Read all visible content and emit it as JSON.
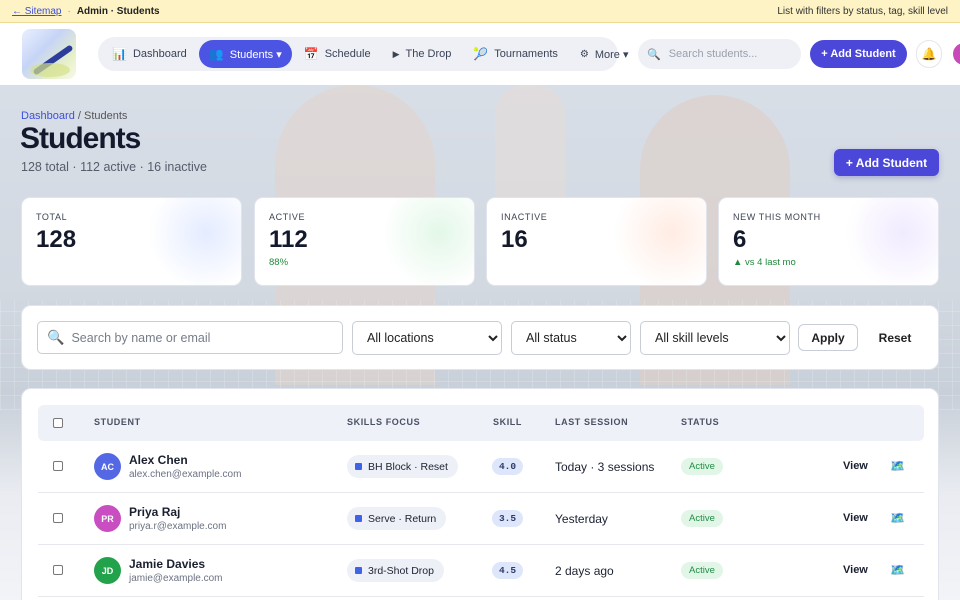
{
  "topbar": {
    "sitemap_link": "← Sitemap",
    "separator": "·",
    "current": "Admin · Students",
    "description": "List with filters by status, tag, skill level"
  },
  "nav": {
    "items": [
      {
        "icon": "📊",
        "label": "Dashboard",
        "active": false
      },
      {
        "icon": "👥",
        "label": "Students ▾",
        "active": true
      },
      {
        "icon": "📅",
        "label": "Schedule",
        "active": false
      },
      {
        "icon": "▶",
        "label": "The Drop",
        "active": false
      },
      {
        "icon": "🎾",
        "label": "Tournaments",
        "active": false
      },
      {
        "icon": "⚙",
        "label": "More ▾",
        "active": false
      }
    ],
    "search_placeholder": "Search students...",
    "add_student": "+ Add Student",
    "bell_icon": "🔔"
  },
  "page": {
    "breadcrumb_root": "Dashboard",
    "breadcrumb_sep": " / ",
    "breadcrumb_current": "Students",
    "title": "Students",
    "subtitle": "128 total · 112 active · 16 inactive",
    "add_student": "+ Add Student"
  },
  "stats": [
    {
      "label": "TOTAL",
      "value": "128",
      "note": "",
      "tint": "#c9d8ff"
    },
    {
      "label": "ACTIVE",
      "value": "112",
      "note": "88%",
      "tint": "#c8f0d2"
    },
    {
      "label": "INACTIVE",
      "value": "16",
      "note": "",
      "tint": "#ffd9c7"
    },
    {
      "label": "NEW THIS MONTH",
      "value": "6",
      "note": "▲ vs 4 last mo",
      "tint": "#e3d6ff"
    }
  ],
  "filters": {
    "search_placeholder": "Search by name or email",
    "location": "All locations",
    "status": "All status",
    "skill": "All skill levels",
    "apply": "Apply",
    "reset": "Reset"
  },
  "table": {
    "headers": {
      "student": "STUDENT",
      "focus": "SKILLS FOCUS",
      "skill": "SKILL",
      "last": "LAST SESSION",
      "status": "STATUS"
    },
    "rows": [
      {
        "initials": "AC",
        "color": "#5468e6",
        "name": "Alex Chen",
        "email": "alex.chen@example.com",
        "focus": "BH Block · Reset",
        "skill": "4.0",
        "last": "Today · 3 sessions",
        "status": "Active",
        "view": "View"
      },
      {
        "initials": "PR",
        "color": "#c94ec1",
        "name": "Priya Raj",
        "email": "priya.r@example.com",
        "focus": "Serve · Return",
        "skill": "3.5",
        "last": "Yesterday",
        "status": "Active",
        "view": "View"
      },
      {
        "initials": "JD",
        "color": "#22a24a",
        "name": "Jamie Davies",
        "email": "jamie@example.com",
        "focus": "3rd-Shot Drop",
        "skill": "4.5",
        "last": "2 days ago",
        "status": "Active",
        "view": "View"
      }
    ],
    "action_icon": "🗺️"
  }
}
